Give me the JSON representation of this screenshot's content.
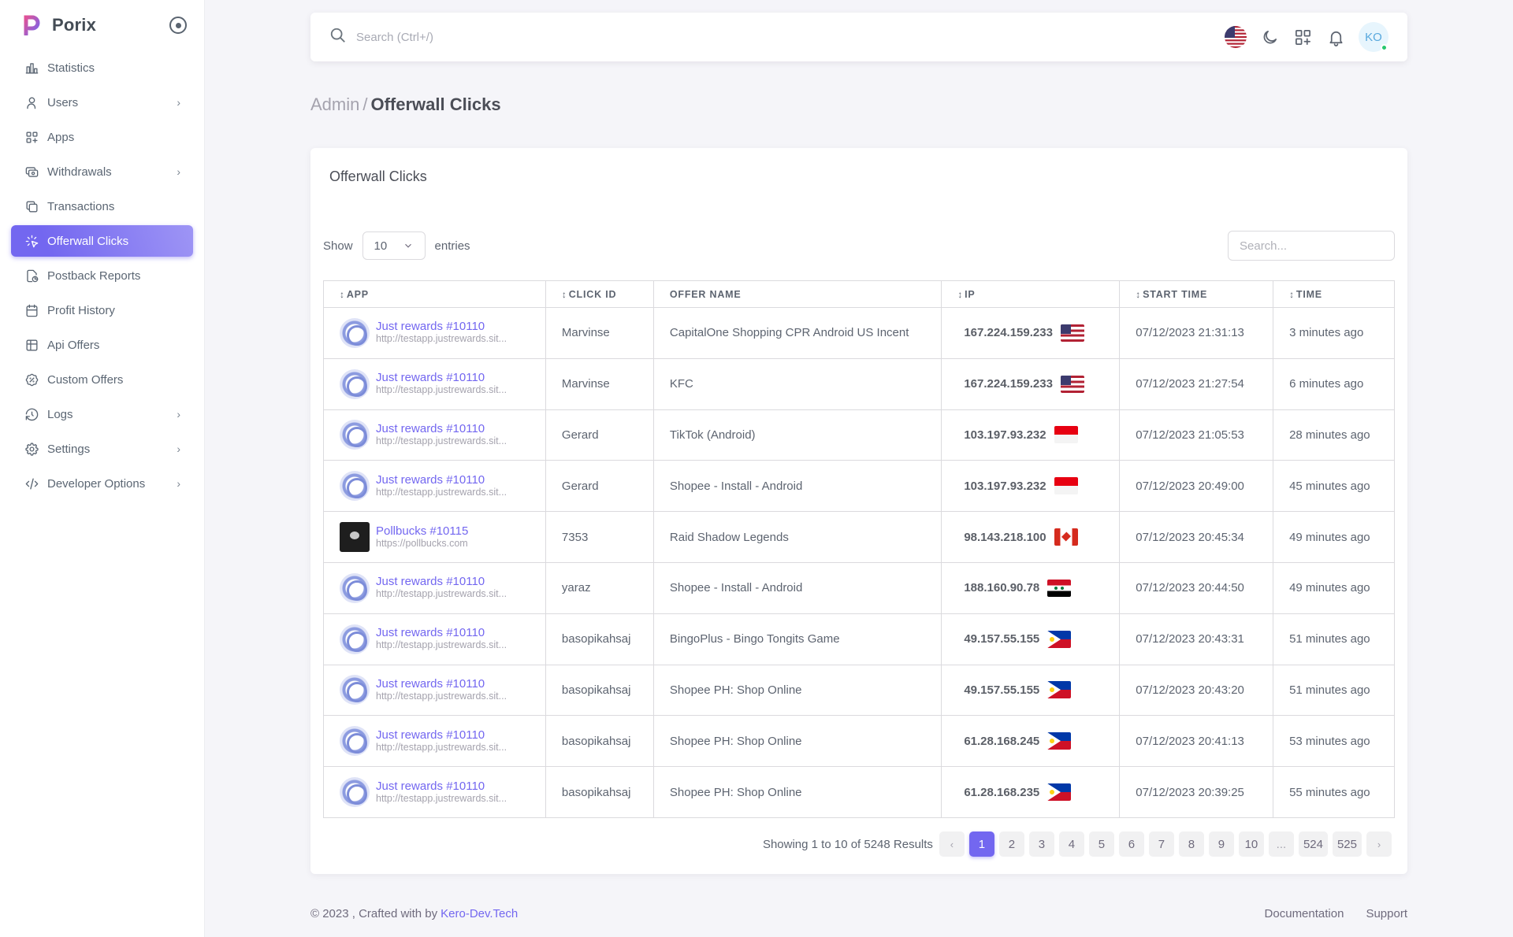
{
  "brand": {
    "name": "Porix",
    "accent": "#7367f0"
  },
  "sidebar": {
    "items": [
      {
        "label": "Statistics",
        "icon": "bar-chart-icon",
        "chevron": ""
      },
      {
        "label": "Users",
        "icon": "user-icon",
        "chevron": "›"
      },
      {
        "label": "Apps",
        "icon": "apps-icon",
        "chevron": ""
      },
      {
        "label": "Withdrawals",
        "icon": "cash-icon",
        "chevron": "›"
      },
      {
        "label": "Transactions",
        "icon": "copy-icon",
        "chevron": ""
      },
      {
        "label": "Offerwall Clicks",
        "icon": "click-icon",
        "chevron": "",
        "active": true
      },
      {
        "label": "Postback Reports",
        "icon": "file-report-icon",
        "chevron": ""
      },
      {
        "label": "Profit History",
        "icon": "calendar-icon",
        "chevron": ""
      },
      {
        "label": "Api Offers",
        "icon": "table-icon",
        "chevron": ""
      },
      {
        "label": "Custom Offers",
        "icon": "discount-icon",
        "chevron": ""
      },
      {
        "label": "Logs",
        "icon": "history-icon",
        "chevron": "›"
      },
      {
        "label": "Settings",
        "icon": "gear-icon",
        "chevron": "›"
      },
      {
        "label": "Developer Options",
        "icon": "code-icon",
        "chevron": "›"
      }
    ]
  },
  "topbar": {
    "search_placeholder": "Search (Ctrl+/)",
    "avatar_initials": "KO"
  },
  "breadcrumb": {
    "parent": "Admin",
    "separator": "/",
    "current": "Offerwall Clicks"
  },
  "card": {
    "title": "Offerwall Clicks",
    "show_label": "Show",
    "entries_value": "10",
    "entries_label": "entries",
    "search_placeholder": "Search..."
  },
  "table": {
    "columns": [
      {
        "label": "APP",
        "sortable": true
      },
      {
        "label": "CLICK ID",
        "sortable": true
      },
      {
        "label": "OFFER NAME",
        "sortable": false
      },
      {
        "label": "IP",
        "sortable": true
      },
      {
        "label": "START TIME",
        "sortable": true
      },
      {
        "label": "TIME",
        "sortable": true
      }
    ],
    "rows": [
      {
        "app": "Just rewards #10110",
        "url": "http://testapp.justrewards.sit...",
        "avatar": "globe",
        "click_id": "Marvinse",
        "offer": "CapitalOne Shopping CPR Android US Incent",
        "ip": "167.224.159.233",
        "flag": "us",
        "start": "07/12/2023 21:31:13",
        "time": "3 minutes ago"
      },
      {
        "app": "Just rewards #10110",
        "url": "http://testapp.justrewards.sit...",
        "avatar": "globe",
        "click_id": "Marvinse",
        "offer": "KFC",
        "ip": "167.224.159.233",
        "flag": "us",
        "start": "07/12/2023 21:27:54",
        "time": "6 minutes ago"
      },
      {
        "app": "Just rewards #10110",
        "url": "http://testapp.justrewards.sit...",
        "avatar": "globe",
        "click_id": "Gerard",
        "offer": "TikTok (Android)",
        "ip": "103.197.93.232",
        "flag": "id",
        "start": "07/12/2023 21:05:53",
        "time": "28 minutes ago"
      },
      {
        "app": "Just rewards #10110",
        "url": "http://testapp.justrewards.sit...",
        "avatar": "globe",
        "click_id": "Gerard",
        "offer": "Shopee - Install - Android",
        "ip": "103.197.93.232",
        "flag": "id",
        "start": "07/12/2023 20:49:00",
        "time": "45 minutes ago"
      },
      {
        "app": "Pollbucks #10115",
        "url": "https://pollbucks.com",
        "avatar": "dark",
        "click_id": "7353",
        "offer": "Raid Shadow Legends",
        "ip": "98.143.218.100",
        "flag": "ca",
        "start": "07/12/2023 20:45:34",
        "time": "49 minutes ago"
      },
      {
        "app": "Just rewards #10110",
        "url": "http://testapp.justrewards.sit...",
        "avatar": "globe",
        "click_id": "yaraz",
        "offer": "Shopee - Install - Android",
        "ip": "188.160.90.78",
        "flag": "sy",
        "start": "07/12/2023 20:44:50",
        "time": "49 minutes ago"
      },
      {
        "app": "Just rewards #10110",
        "url": "http://testapp.justrewards.sit...",
        "avatar": "globe",
        "click_id": "basopikahsaj",
        "offer": "BingoPlus - Bingo Tongits Game",
        "ip": "49.157.55.155",
        "flag": "ph",
        "start": "07/12/2023 20:43:31",
        "time": "51 minutes ago"
      },
      {
        "app": "Just rewards #10110",
        "url": "http://testapp.justrewards.sit...",
        "avatar": "globe",
        "click_id": "basopikahsaj",
        "offer": "Shopee PH: Shop Online",
        "ip": "49.157.55.155",
        "flag": "ph",
        "start": "07/12/2023 20:43:20",
        "time": "51 minutes ago"
      },
      {
        "app": "Just rewards #10110",
        "url": "http://testapp.justrewards.sit...",
        "avatar": "globe",
        "click_id": "basopikahsaj",
        "offer": "Shopee PH: Shop Online",
        "ip": "61.28.168.245",
        "flag": "ph",
        "start": "07/12/2023 20:41:13",
        "time": "53 minutes ago"
      },
      {
        "app": "Just rewards #10110",
        "url": "http://testapp.justrewards.sit...",
        "avatar": "globe",
        "click_id": "basopikahsaj",
        "offer": "Shopee PH: Shop Online",
        "ip": "61.28.168.235",
        "flag": "ph",
        "start": "07/12/2023 20:39:25",
        "time": "55 minutes ago"
      }
    ]
  },
  "pagination": {
    "info": "Showing 1 to 10 of 5248 Results",
    "prev": "‹",
    "next": "›",
    "pages": [
      "1",
      "2",
      "3",
      "4",
      "5",
      "6",
      "7",
      "8",
      "9",
      "10",
      "...",
      "524",
      "525"
    ],
    "active": "1"
  },
  "footer": {
    "copyright": "© 2023 , Crafted with by",
    "brand_link": "Kero-Dev.Tech",
    "links": [
      "Documentation",
      "Support"
    ]
  }
}
